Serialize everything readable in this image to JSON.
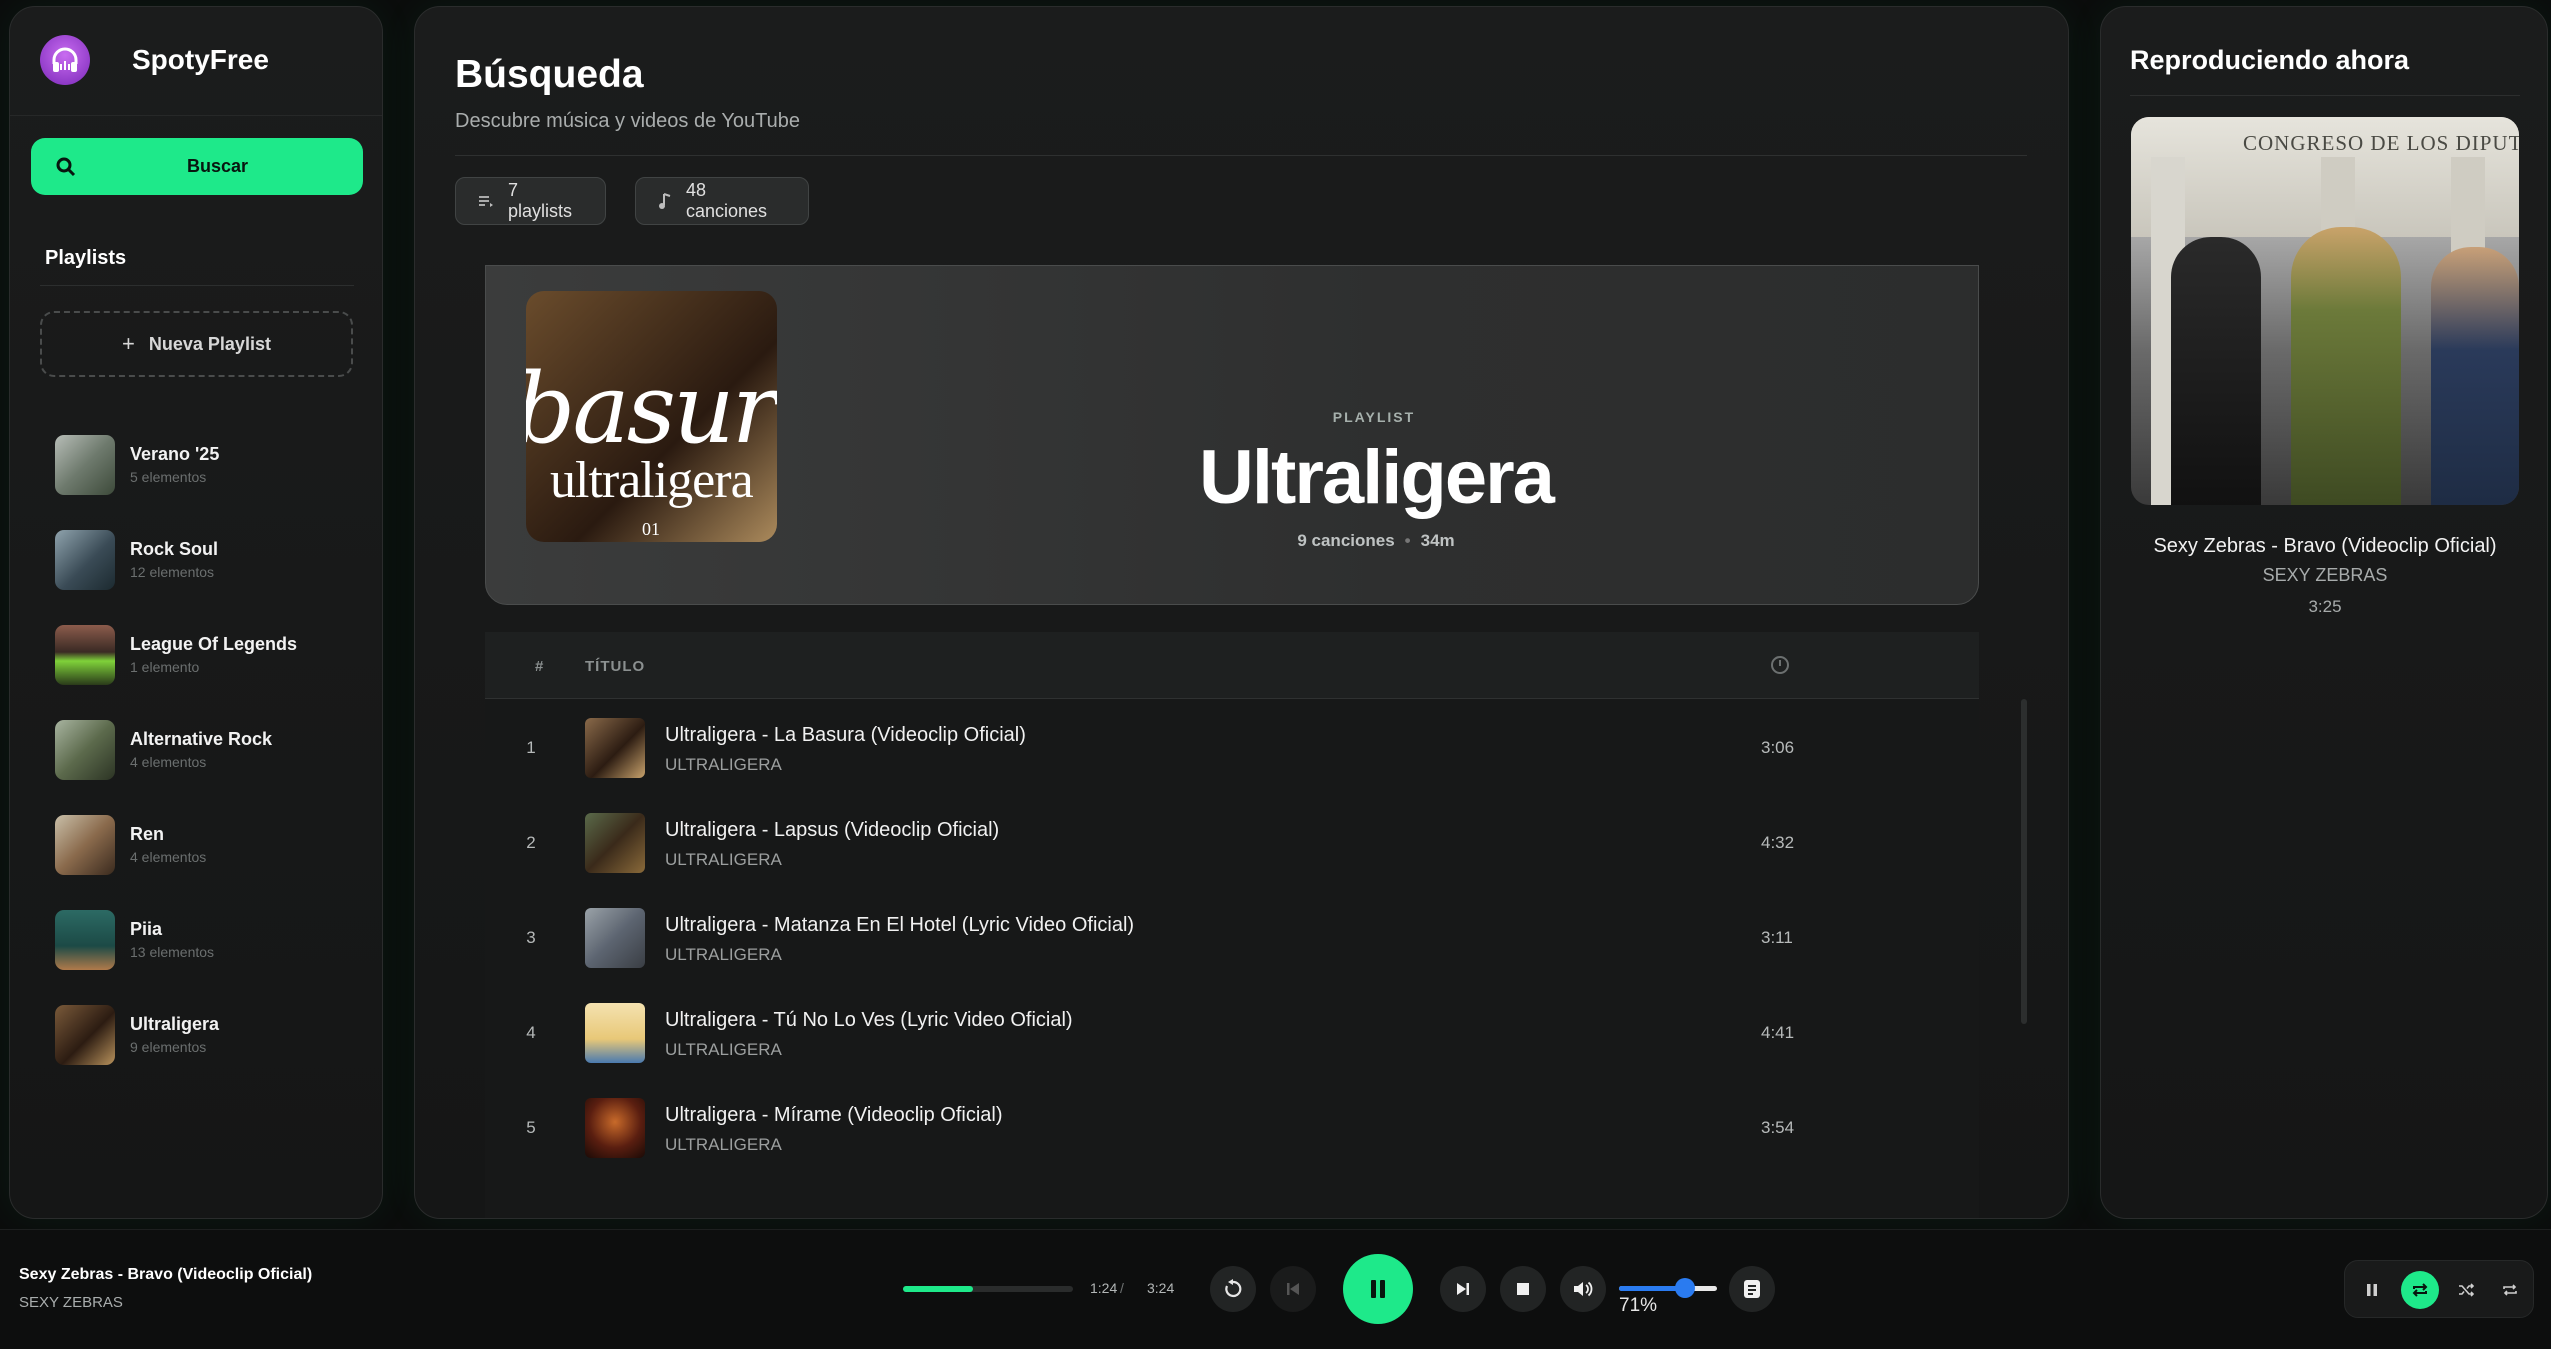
{
  "app": {
    "name": "SpotyFree"
  },
  "sidebar": {
    "search_label": "Buscar",
    "playlists_title": "Playlists",
    "new_playlist_label": "Nueva Playlist",
    "items": [
      {
        "name": "Verano '25",
        "count": "5 elementos"
      },
      {
        "name": "Rock Soul",
        "count": "12 elementos"
      },
      {
        "name": "League Of Legends",
        "count": "1 elemento"
      },
      {
        "name": "Alternative Rock",
        "count": "4 elementos"
      },
      {
        "name": "Ren",
        "count": "4 elementos"
      },
      {
        "name": "Piia",
        "count": "13 elementos"
      },
      {
        "name": "Ultraligera",
        "count": "9 elementos"
      }
    ]
  },
  "main": {
    "title": "Búsqueda",
    "subtitle": "Descubre música y videos de YouTube",
    "chips": {
      "playlists": "7 playlists",
      "songs": "48 canciones"
    },
    "hero": {
      "type": "PLAYLIST",
      "name": "Ultraligera",
      "songs": "9 canciones",
      "duration": "34m",
      "cover_text_big": "basur",
      "cover_text_small": "ultraligera",
      "cover_text_num": "01"
    },
    "table": {
      "headers": {
        "num": "#",
        "title": "TÍTULO"
      },
      "rows": [
        {
          "num": "1",
          "title": "Ultraligera - La Basura (Videoclip Oficial)",
          "artist": "ULTRALIGERA",
          "duration": "3:06"
        },
        {
          "num": "2",
          "title": "Ultraligera - Lapsus (Videoclip Oficial)",
          "artist": "ULTRALIGERA",
          "duration": "4:32"
        },
        {
          "num": "3",
          "title": "Ultraligera - Matanza En El Hotel (Lyric Video Oficial)",
          "artist": "ULTRALIGERA",
          "duration": "3:11"
        },
        {
          "num": "4",
          "title": "Ultraligera - Tú No Lo Ves (Lyric Video Oficial)",
          "artist": "ULTRALIGERA",
          "duration": "4:41"
        },
        {
          "num": "5",
          "title": "Ultraligera - Mírame (Videoclip Oficial)",
          "artist": "ULTRALIGERA",
          "duration": "3:54"
        }
      ]
    }
  },
  "now_playing": {
    "title": "Reproduciendo ahora",
    "song": "Sexy Zebras - Bravo (Videoclip Oficial)",
    "artist": "SEXY ZEBRAS",
    "duration": "3:25",
    "cover_sign": "CONGRESO DE LOS DIPUTAD"
  },
  "player": {
    "song": "Sexy Zebras - Bravo (Videoclip Oficial)",
    "artist": "SEXY ZEBRAS",
    "current_time": "1:24",
    "slash": "/",
    "total_time": "3:24",
    "progress": 0.41,
    "volume_label": "71%",
    "volume": 0.71
  },
  "colors": {
    "accent": "#1ee98a",
    "volume": "#2a7bf0"
  }
}
